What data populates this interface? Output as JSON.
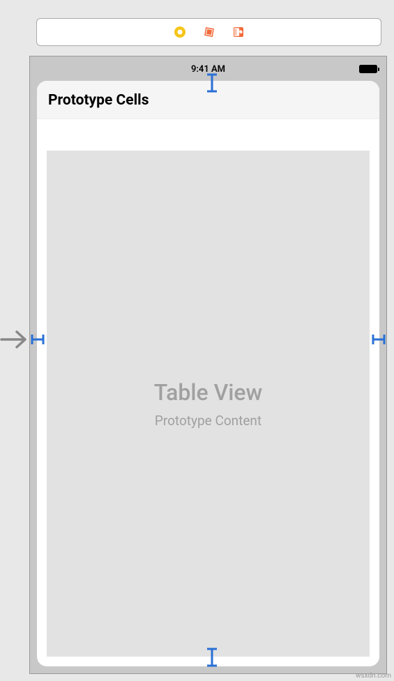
{
  "statusBar": {
    "time": "9:41 AM"
  },
  "sectionHeader": {
    "title": "Prototype Cells"
  },
  "tableView": {
    "title": "Table View",
    "subtitle": "Prototype Content"
  },
  "watermark": "wsxdn.com"
}
